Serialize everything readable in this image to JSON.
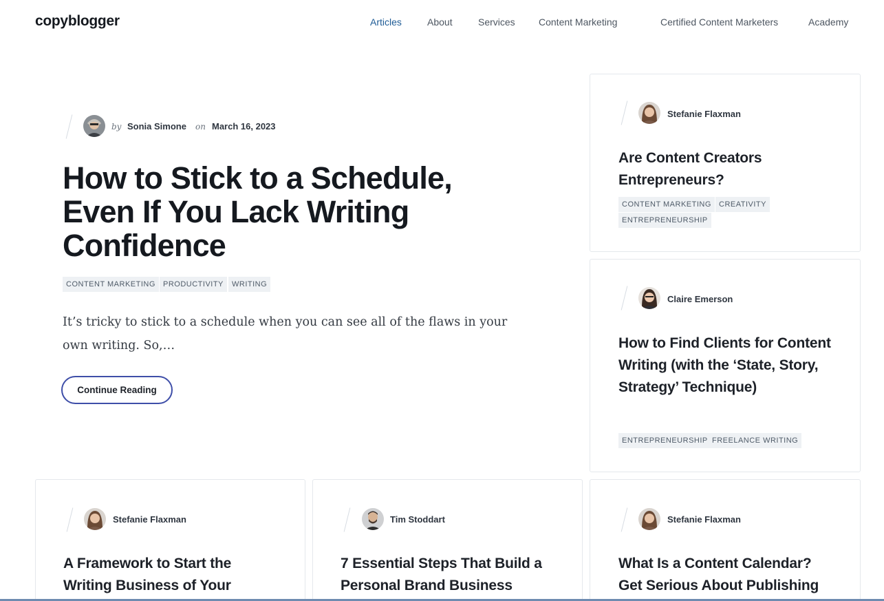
{
  "header": {
    "logo": "copyblogger",
    "nav": [
      {
        "label": "Articles",
        "active": true
      },
      {
        "label": "About",
        "active": false
      },
      {
        "label": "Services",
        "active": false
      },
      {
        "label": "Content Marketing",
        "active": false
      },
      {
        "label": "Certified Content Marketers",
        "active": false
      },
      {
        "label": "Academy",
        "active": false
      }
    ]
  },
  "featured": {
    "by": "by",
    "author": "Sonia Simone",
    "on": "on",
    "date": "March 16, 2023",
    "title": "How to Stick to a Schedule, Even If You Lack Writing Confidence",
    "tags": [
      "CONTENT MARKETING",
      "PRODUCTIVITY",
      "WRITING"
    ],
    "excerpt": "It’s tricky to stick to a schedule when you can see all of the flaws in your own writing. So,…",
    "button": "Continue Reading"
  },
  "cards": [
    {
      "author": "Stefanie Flaxman",
      "title": "Are Content Creators Entrepreneurs?",
      "tags": [
        "CONTENT MARKETING",
        "CREATIVITY",
        "ENTREPRENEURSHIP"
      ]
    },
    {
      "author": "Claire Emerson",
      "title": "How to Find Clients for Content Writing (with the ‘State, Story, Strategy’ Technique)",
      "tags": [
        "ENTREPRENEURSHIP",
        "FREELANCE WRITING"
      ]
    },
    {
      "author": "Stefanie Flaxman",
      "title": "A Framework to Start the Writing Business of Your",
      "tags": []
    },
    {
      "author": "Tim Stoddart",
      "title": "7 Essential Steps That Build a Personal Brand Business",
      "tags": []
    },
    {
      "author": "Stefanie Flaxman",
      "title": "What Is a Content Calendar? Get Serious About Publishing",
      "tags": []
    }
  ],
  "colors": {
    "accent": "#1f5c96",
    "button_border": "#3e4ea8",
    "tag_bg": "#eef1f4"
  }
}
